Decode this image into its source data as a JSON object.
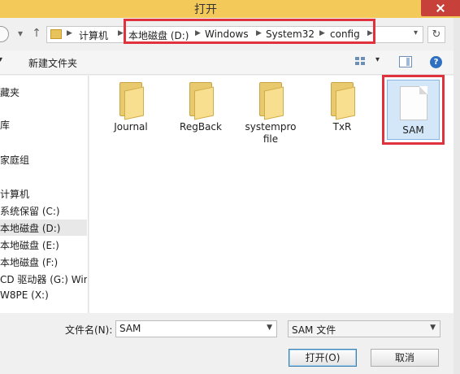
{
  "window": {
    "title": "打开"
  },
  "address": {
    "crumbs": [
      "计算机",
      "本地磁盘 (D:)",
      "Windows",
      "System32",
      "config"
    ]
  },
  "toolbar": {
    "new_folder_label": "新建文件夹"
  },
  "sidebar": {
    "items": [
      {
        "label": "藏夹"
      },
      {
        "label": "库"
      },
      {
        "label": "家庭组"
      },
      {
        "label": "计算机"
      },
      {
        "label": "系统保留 (C:)"
      },
      {
        "label": "本地磁盘 (D:)",
        "selected": true
      },
      {
        "label": "本地磁盘 (E:)"
      },
      {
        "label": "本地磁盘 (F:)"
      },
      {
        "label": "CD 驱动器 (G:) Win"
      },
      {
        "label": "W8PE (X:)"
      }
    ]
  },
  "files": [
    {
      "name": "Journal",
      "kind": "folder"
    },
    {
      "name": "RegBack",
      "kind": "folder"
    },
    {
      "name": "systempro\nfile",
      "kind": "folder"
    },
    {
      "name": "TxR",
      "kind": "folder"
    },
    {
      "name": "SAM",
      "kind": "file",
      "selected": true
    }
  ],
  "footer": {
    "filename_label": "文件名(N):",
    "filename_value": "SAM",
    "filetype_value": "SAM 文件",
    "open_label": "打开(O)",
    "cancel_label": "取消"
  },
  "colors": {
    "title_bar": "#f3c95a",
    "highlight": "#e0323c",
    "close": "#c7413a"
  }
}
